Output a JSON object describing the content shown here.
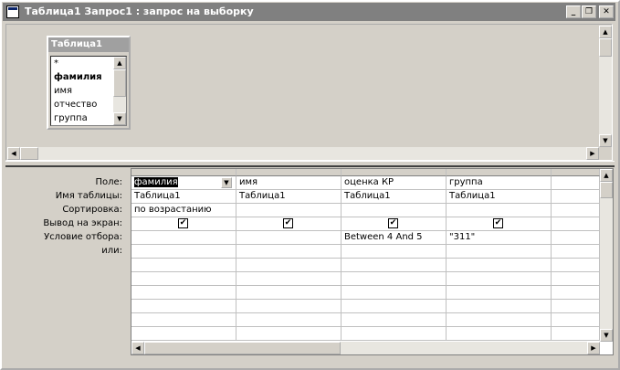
{
  "window": {
    "title": "Таблица1 Запрос1 : запрос на выборку",
    "buttons": {
      "minimize": "_",
      "restore": "❐",
      "close": "✕"
    }
  },
  "table_box": {
    "title": "Таблица1",
    "fields": [
      "*",
      "фамилия",
      "имя",
      "отчество",
      "группа"
    ]
  },
  "grid": {
    "row_labels": [
      "Поле:",
      "Имя таблицы:",
      "Сортировка:",
      "Вывод на экран:",
      "Условие отбора:",
      "или:"
    ],
    "columns": [
      {
        "field": "фамилия",
        "table": "Таблица1",
        "sort": "по возрастанию",
        "show": true,
        "criteria": ""
      },
      {
        "field": "имя",
        "table": "Таблица1",
        "sort": "",
        "show": true,
        "criteria": ""
      },
      {
        "field": "оценка КР",
        "table": "Таблица1",
        "sort": "",
        "show": true,
        "criteria": "Between 4 And 5"
      },
      {
        "field": "группа",
        "table": "Таблица1",
        "sort": "",
        "show": true,
        "criteria": "\"311\""
      }
    ]
  },
  "icons": {
    "window": "query-icon",
    "check": "checkmark-icon",
    "arrows": "scroll-arrow-icon"
  }
}
